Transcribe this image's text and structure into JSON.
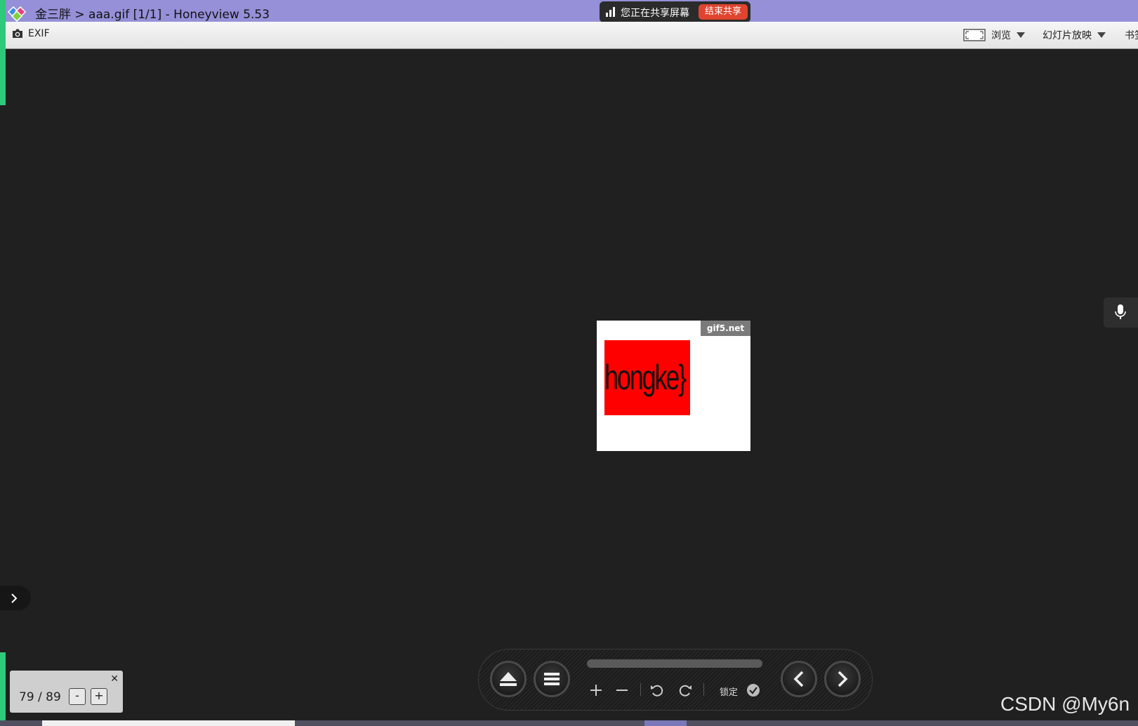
{
  "titlebar": {
    "title": "金三胖 > aaa.gif [1/1] - Honeyview 5.53",
    "share_text": "您正在共享屏幕",
    "end_share_label": "结束共享"
  },
  "toolbar": {
    "exif_label": "EXIF",
    "browse_label": "浏览",
    "slideshow_label": "幻灯片放映",
    "bookmark_label": "书签"
  },
  "image": {
    "watermark": "gif5.net",
    "text": "hongke}"
  },
  "counter": {
    "pages": "79 / 89",
    "minus_label": "-",
    "plus_label": "+",
    "close_symbol": "✕"
  },
  "controls": {
    "lock_label": "锁定"
  },
  "footer": {
    "watermark": "CSDN @My6n"
  },
  "colors": {
    "titlebar": "#9590d8",
    "viewer_background": "#202020",
    "accent_green": "#2ec97a",
    "end_share": "#e0442e"
  }
}
